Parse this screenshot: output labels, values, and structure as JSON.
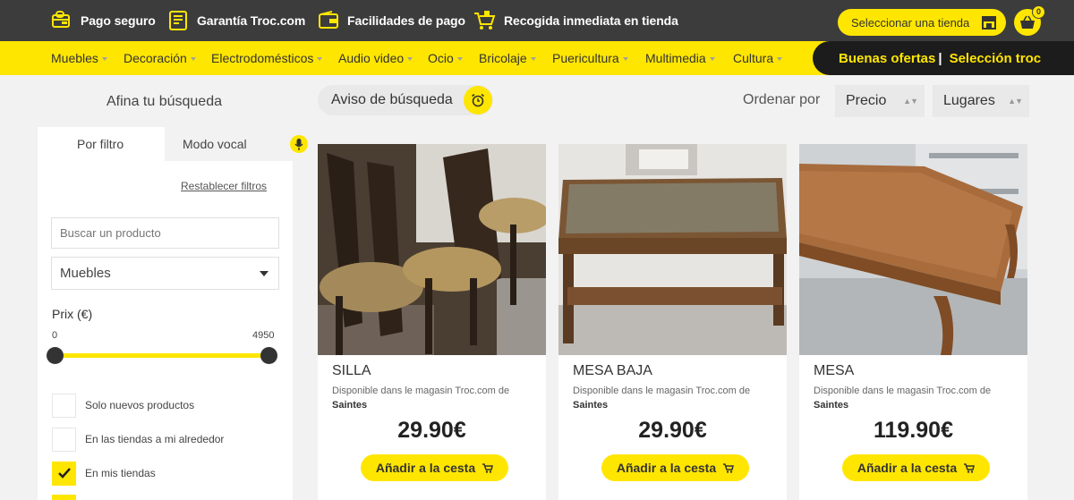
{
  "topbar": {
    "features": [
      {
        "icon": "secure-payment-icon",
        "label": "Pago seguro"
      },
      {
        "icon": "warranty-icon",
        "label": "Garantía Troc.com"
      },
      {
        "icon": "payment-wallet-icon",
        "label": "Facilidades de pago"
      },
      {
        "icon": "store-pickup-cart-icon",
        "label": "Recogida inmediata en tienda"
      }
    ],
    "store_select_label": "Seleccionar una tienda",
    "cart_count": "0"
  },
  "nav": {
    "categories": [
      "Muebles",
      "Decoración",
      "Electrodomésticos",
      "Audio video",
      "Ocio",
      "Bricolaje",
      "Puericultura",
      "Multimedia",
      "Cultura"
    ],
    "deals_label": "Buenas ofertas",
    "deals_sep": "|",
    "selection_label": "Selección troc"
  },
  "sidebar": {
    "title": "Afina tu búsqueda",
    "tab_filter": "Por filtro",
    "tab_voice": "Modo vocal",
    "reset_label": "Restablecer filtros",
    "search_placeholder": "Buscar un producto",
    "category_selected": "Muebles",
    "price_label": "Prix (€)",
    "price_min": "0",
    "price_max": "4950",
    "options": [
      {
        "label": "Solo nuevos productos",
        "checked": false
      },
      {
        "label": "En las tiendas a mi alrededor",
        "checked": false
      },
      {
        "label": "En mis tiendas",
        "checked": true
      }
    ]
  },
  "toolbar": {
    "alert_label": "Aviso de búsqueda",
    "sort_label": "Ordenar por",
    "sort_price": "Precio",
    "sort_places": "Lugares"
  },
  "products": [
    {
      "name": "SILLA",
      "availability": "Disponible dans le magasin Troc.com de",
      "store": "Saintes",
      "price": "29.90€",
      "add_label": "Añadir a la cesta"
    },
    {
      "name": "MESA BAJA",
      "availability": "Disponible dans le magasin Troc.com de",
      "store": "Saintes",
      "price": "29.90€",
      "add_label": "Añadir a la cesta"
    },
    {
      "name": "MESA",
      "availability": "Disponible dans le magasin Troc.com de",
      "store": "Saintes",
      "price": "119.90€",
      "add_label": "Añadir a la cesta"
    }
  ],
  "colors": {
    "accent": "#ffe600",
    "dark": "#3c3c3c",
    "black": "#1c1c1c"
  }
}
